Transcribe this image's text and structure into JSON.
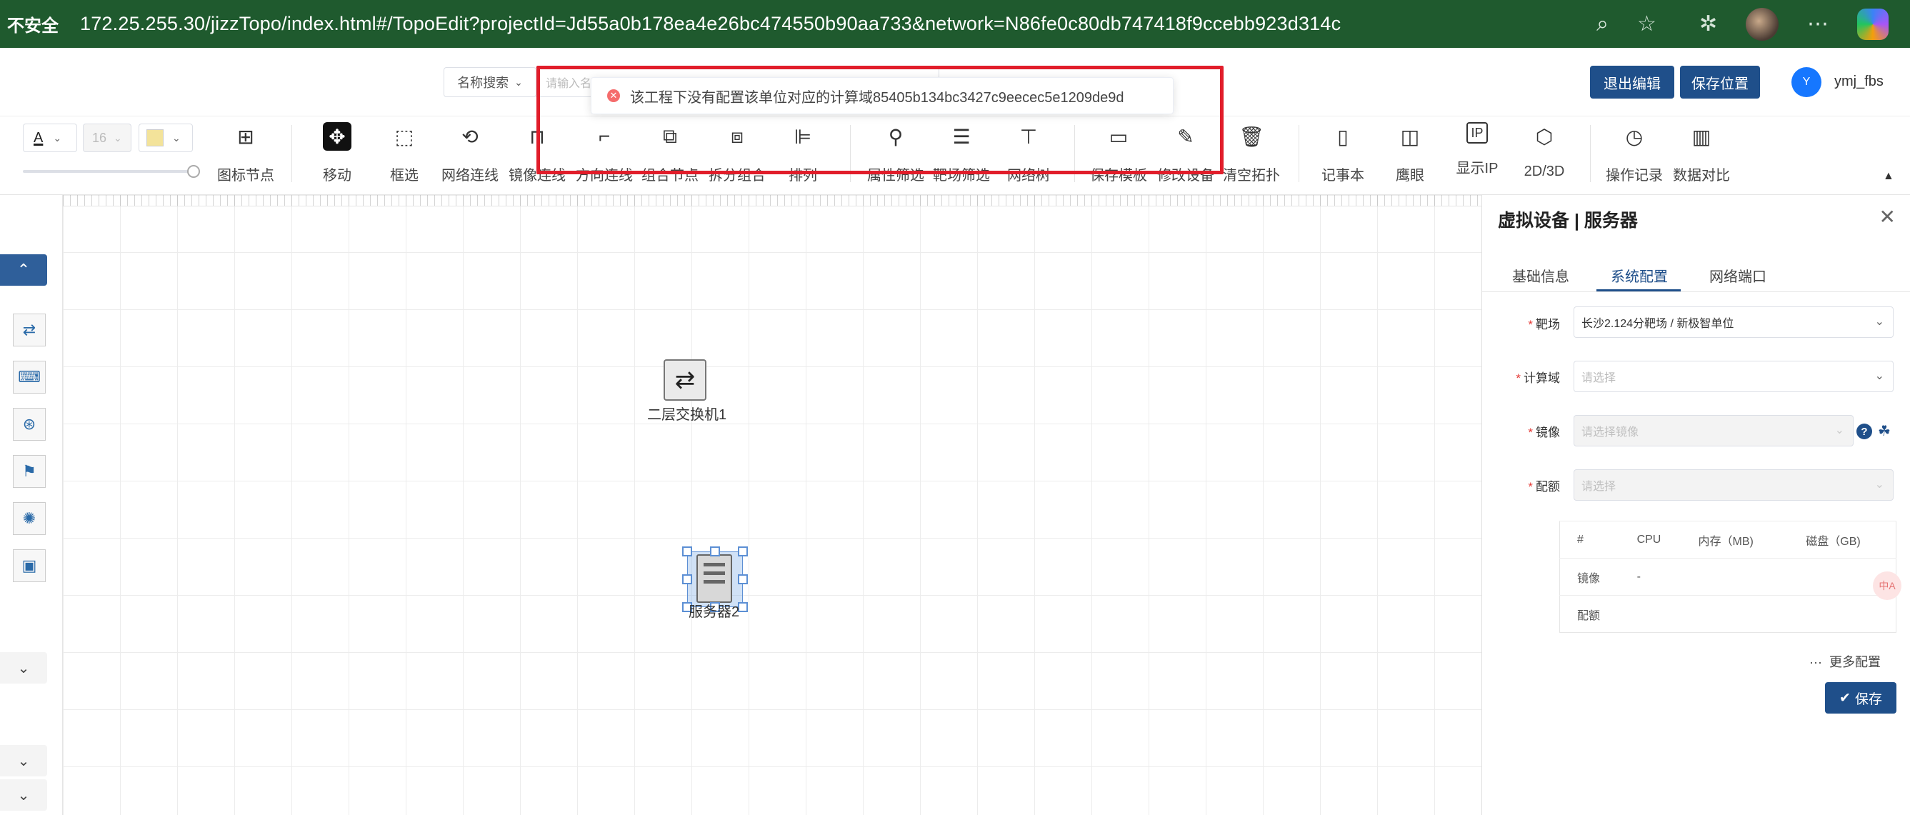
{
  "browser": {
    "insecure_label": "不安全",
    "url": "172.25.255.30/jizzTopo/index.html#/TopoEdit?projectId=Jd55a0b178ea4e26bc474550b90aa733&network=N86fe0c80db747418f9ccebb923d314c"
  },
  "header": {
    "search_type": "名称搜索",
    "search_placeholder": "请输入名称",
    "exit_edit": "退出编辑",
    "save_position": "保存位置",
    "avatar_letter": "Y",
    "username": "ymj_fbs"
  },
  "toast": {
    "message": "该工程下没有配置该单位对应的计算域85405b134bc3427c9eecec5e1209de9d"
  },
  "toolbar": {
    "font_size": "16",
    "tools": [
      {
        "label": "图标节点",
        "icon": "⊞"
      },
      {
        "label": "移动",
        "icon": "✥"
      },
      {
        "label": "框选",
        "icon": "⬚"
      },
      {
        "label": "网络连线",
        "icon": "⟲"
      },
      {
        "label": "镜像连线",
        "icon": "⊓"
      },
      {
        "label": "方向连线",
        "icon": "⌐"
      },
      {
        "label": "组合节点",
        "icon": "⧉"
      },
      {
        "label": "拆分组合",
        "icon": "⧈"
      },
      {
        "label": "排列",
        "icon": "⊫"
      },
      {
        "label": "属性筛选",
        "icon": "⚲"
      },
      {
        "label": "靶场筛选",
        "icon": "☰"
      },
      {
        "label": "网络树",
        "icon": "⊤"
      },
      {
        "label": "保存模板",
        "icon": "▭"
      },
      {
        "label": "修改设备",
        "icon": "✎"
      },
      {
        "label": "清空拓扑",
        "icon": "🗑"
      },
      {
        "label": "记事本",
        "icon": "▯"
      },
      {
        "label": "鹰眼",
        "icon": "◫"
      },
      {
        "label": "显示IP",
        "icon": "IP"
      },
      {
        "label": "2D/3D",
        "icon": "⬡"
      },
      {
        "label": "操作记录",
        "icon": "◷"
      },
      {
        "label": "数据对比",
        "icon": "▥"
      }
    ]
  },
  "canvas": {
    "switch_label": "二层交换机1",
    "server_label": "服务器2"
  },
  "panel": {
    "title": "虚拟设备 | 服务器",
    "tabs": [
      "基础信息",
      "系统配置",
      "网络端口"
    ],
    "range_label": "靶场",
    "range_value": "长沙2.124分靶场 / 新极智单位",
    "compute_label": "计算域",
    "compute_placeholder": "请选择",
    "image_label": "镜像",
    "image_placeholder": "请选择镜像",
    "quota_label": "配额",
    "quota_placeholder": "请选择",
    "table": {
      "headers": [
        "#",
        "CPU",
        "内存（MB)",
        "磁盘（GB)"
      ],
      "rows": [
        [
          "镜像",
          "-",
          "",
          ""
        ],
        [
          "配额",
          "",
          "",
          ""
        ]
      ]
    },
    "more_config": "更多配置",
    "more_icon": "···",
    "save": "保存"
  },
  "float": {
    "translate_label": "中A"
  }
}
